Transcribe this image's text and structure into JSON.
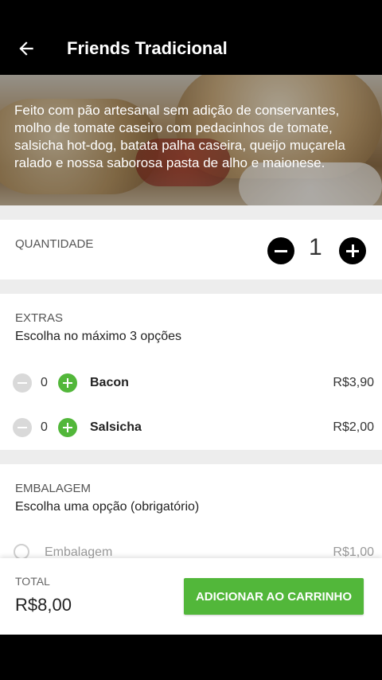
{
  "header": {
    "title": "Friends Tradicional",
    "back_icon": "arrow-left-icon"
  },
  "hero": {
    "description": "Feito com pão artesanal sem adição de conservantes, molho de tomate caseiro com pedacinhos de tomate, salsicha hot-dog, batata palha caseira, queijo muçarela ralado e nossa saborosa pasta de alho e maionese."
  },
  "quantity": {
    "label": "QUANTIDADE",
    "value": "1"
  },
  "extras": {
    "title": "EXTRAS",
    "subtitle": "Escolha no máximo 3 opções",
    "items": [
      {
        "name": "Bacon",
        "count": "0",
        "price": "R$3,90"
      },
      {
        "name": "Salsicha",
        "count": "0",
        "price": "R$2,00"
      }
    ]
  },
  "packaging": {
    "title": "EMBALAGEM",
    "subtitle": "Escolha uma opção (obrigatório)",
    "items": [
      {
        "name": "Embalagem",
        "price": "R$1,00"
      }
    ]
  },
  "footer": {
    "total_label": "TOTAL",
    "total_value": "R$8,00",
    "cta_label": "ADICIONAR AO CARRINHO"
  },
  "colors": {
    "accent": "#52b73a",
    "background": "#ffffff",
    "divider": "#ededed"
  }
}
